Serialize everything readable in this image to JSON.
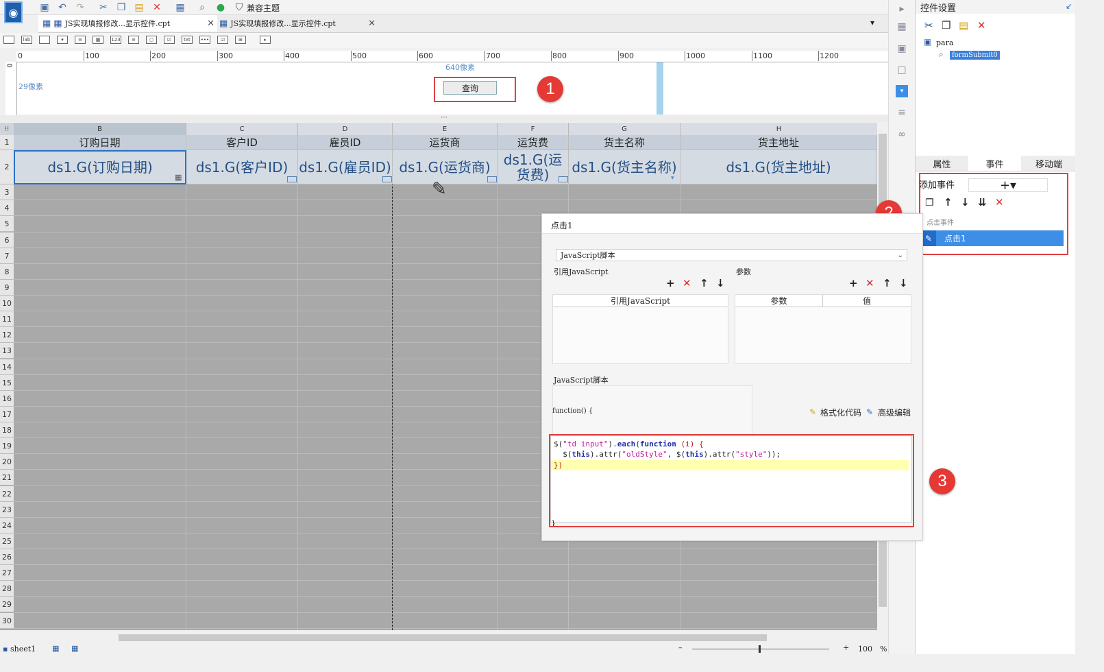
{
  "toolbar": {
    "compat_theme_label": "兼容主题",
    "icons": [
      "save-icon",
      "undo-icon",
      "redo-icon",
      "cut-icon",
      "copy-icon",
      "paste-icon",
      "delete-icon",
      "template-icon",
      "preview-icon",
      "check-icon",
      "shirt-icon"
    ]
  },
  "tabs": [
    {
      "label": "JS实现填报修改...显示控件.cpt"
    },
    {
      "label": "JS实现填报修改...显示控件.cpt"
    }
  ],
  "ruler": {
    "ticks": [
      "0",
      "100",
      "200",
      "300",
      "400",
      "500",
      "600",
      "700",
      "800",
      "900",
      "1000",
      "1100",
      "1200"
    ],
    "vertical_zero": "0"
  },
  "param_panel": {
    "width_label": "640像素",
    "height_label": "29像素",
    "query_button": "查询"
  },
  "markers": [
    "1",
    "2",
    "3"
  ],
  "grid": {
    "columns": [
      "B",
      "C",
      "D",
      "E",
      "F",
      "G",
      "H"
    ],
    "headers": [
      "订购日期",
      "客户ID",
      "雇员ID",
      "运货商",
      "运货费",
      "货主名称",
      "货主地址"
    ],
    "data_row": [
      "ds1.G(订购日期)",
      "ds1.G(客户ID)",
      "ds1.G(雇员ID)",
      "ds1.G(运货商)",
      "ds1.G(运货费)",
      "ds1.G(货主名称)",
      "ds1.G(货主地址)"
    ],
    "row_numbers": [
      "1",
      "2",
      "3",
      "4",
      "5",
      "6",
      "7",
      "8",
      "9",
      "10",
      "11",
      "12",
      "13",
      "14",
      "15",
      "16",
      "17",
      "18",
      "19",
      "20",
      "21",
      "22",
      "23",
      "24",
      "25",
      "26",
      "27",
      "28",
      "29",
      "30"
    ]
  },
  "right_panel": {
    "title": "控件设置",
    "tree_root": "para",
    "tree_child": "formSubmit0",
    "tabs": [
      "属性",
      "事件",
      "移动端"
    ],
    "active_tab": "事件",
    "add_event_label": "添加事件",
    "add_event_symbol": "+▾",
    "event_category": "点击事件",
    "event_item": "点击1"
  },
  "dialog": {
    "title": "点击1",
    "script_type": "JavaScript脚本",
    "ref_js_section": "引用JavaScript",
    "ref_js_column": "引用JavaScript",
    "params_section": "参数",
    "params_col1": "参数",
    "params_col2": "值",
    "script_section": "JavaScript脚本",
    "function_signature": "function() {",
    "format_code_label": "格式化代码",
    "advanced_edit_label": "高级编辑",
    "closing_brace": "}"
  },
  "code": {
    "line1": {
      "a": "$(",
      "b": "\"td input\"",
      "c": ").",
      "d": "each",
      "e": "(",
      "f": "function",
      "g": " (i) {"
    },
    "line2": {
      "a": "  $(",
      "b": "this",
      "c": ").attr(",
      "d": "\"oldStyle\"",
      "e": ", $(",
      "f": "this",
      "g": ").attr(",
      "h": "\"style\"",
      "i": "));"
    },
    "line3": "})"
  },
  "status": {
    "sheet": "sheet1",
    "zoom": "100",
    "zoom_unit": "%",
    "zoom_minus": "–",
    "zoom_plus": "+"
  },
  "colors": {
    "accent": "#3d8ee6",
    "highlight_red": "#e04040",
    "marker_red": "#e53935",
    "cell_text": "#234f86"
  }
}
